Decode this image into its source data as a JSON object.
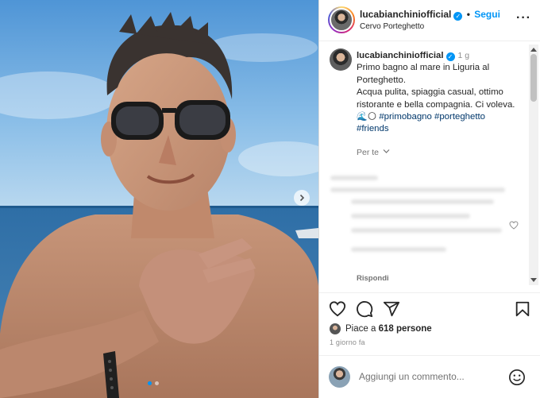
{
  "post": {
    "username": "lucabianchiniofficial",
    "follow_label": "Segui",
    "separator": "•",
    "location": "Cervo Porteghetto",
    "more_icon": "more-horizontal-icon"
  },
  "caption": {
    "username": "lucabianchiniofficial",
    "time_ago": "1 g",
    "line1": "Primo bagno al mare in Liguria al Porteghetto.",
    "line2": "Acqua pulita, spiaggia casual, ottimo ristorante e bella compagnia. Ci voleva.",
    "emojis": "🌊🌕",
    "hashtags": [
      "#primobagno",
      "#porteghetto",
      "#friends"
    ],
    "translate_label": "Per te"
  },
  "comment": {
    "reply_label": "Rispondi"
  },
  "actions": {
    "icons": [
      "heart-icon",
      "comment-icon",
      "share-icon",
      "bookmark-icon"
    ]
  },
  "likes": {
    "prefix": "Piace a ",
    "count": "618 persone"
  },
  "posted_date": "1 giorno fa",
  "composer": {
    "placeholder": "Aggiungi un commento...",
    "emoji_icon": "emoji-icon"
  },
  "carousel": {
    "slides": 2,
    "active_slide": 1
  },
  "colors": {
    "accent": "#0095f6",
    "hashtag": "#00376b",
    "text": "#262626",
    "muted": "#8e8e8e"
  }
}
